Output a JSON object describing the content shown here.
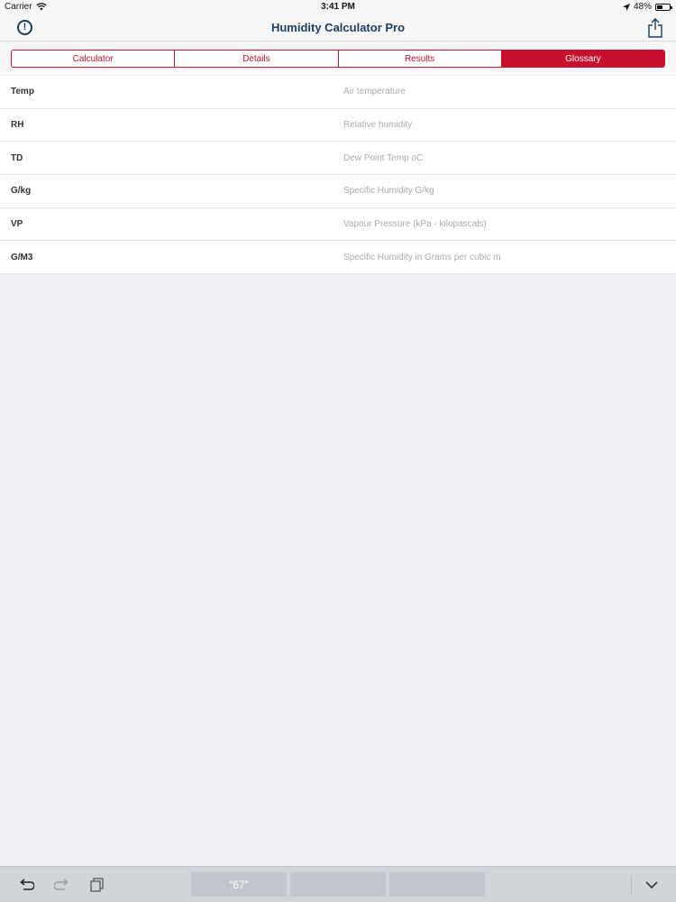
{
  "status": {
    "carrier": "Carrier",
    "time": "3:41 PM",
    "battery": "48%",
    "battery_level": 0.48
  },
  "nav": {
    "title": "Humidity Calculator Pro",
    "info_icon": "info-circle-icon",
    "share_icon": "share-icon"
  },
  "tabs": [
    {
      "label": "Calculator",
      "active": false
    },
    {
      "label": "Details",
      "active": false
    },
    {
      "label": "Results",
      "active": false
    },
    {
      "label": "Glossary",
      "active": true
    }
  ],
  "glossary": [
    {
      "term": "Temp",
      "definition": "Air temperature"
    },
    {
      "term": "RH",
      "definition": "Relative humidity"
    },
    {
      "term": "TD",
      "definition": "Dew Point Temp oC"
    },
    {
      "term": "G/kg",
      "definition": "Specific Humidity G/kg"
    },
    {
      "term": "VP",
      "definition": "Vapour Pressure (kPa - kilopascals)"
    },
    {
      "term": "G/M3",
      "definition": "Specific Humidity in Grams per cubic m"
    }
  ],
  "keyboard_bar": {
    "suggestions": [
      "“67”",
      "",
      ""
    ],
    "icons": [
      "undo-icon",
      "redo-icon",
      "paste-icon",
      "chevron-down-icon"
    ]
  },
  "colors": {
    "accent": "#c8102e",
    "title": "#1c3d5e"
  }
}
